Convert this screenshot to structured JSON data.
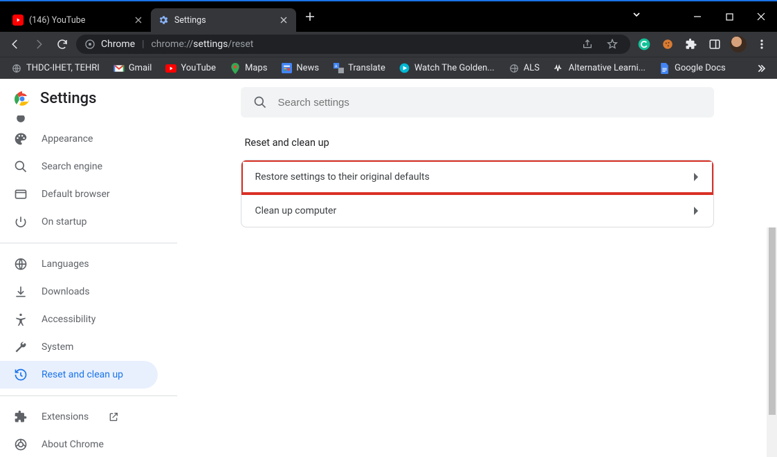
{
  "tabs": [
    {
      "title": "(146) YouTube",
      "favicon": "youtube",
      "active": false
    },
    {
      "title": "Settings",
      "favicon": "settings",
      "active": true
    }
  ],
  "omnibox": {
    "prefix": "Chrome",
    "path_grey1": "chrome://",
    "path_white": "settings",
    "path_grey2": "/reset"
  },
  "bookmarks": [
    {
      "label": "THDC-IHET, TEHRI",
      "icon": "globe"
    },
    {
      "label": "Gmail",
      "icon": "gmail"
    },
    {
      "label": "YouTube",
      "icon": "youtube"
    },
    {
      "label": "Maps",
      "icon": "maps"
    },
    {
      "label": "News",
      "icon": "news"
    },
    {
      "label": "Translate",
      "icon": "translate"
    },
    {
      "label": "Watch The Golden...",
      "icon": "play"
    },
    {
      "label": "ALS",
      "icon": "globe"
    },
    {
      "label": "Alternative Learni...",
      "icon": "wave"
    },
    {
      "label": "Google Docs",
      "icon": "docs"
    }
  ],
  "settings": {
    "title": "Settings",
    "search_placeholder": "Search settings",
    "nav": [
      {
        "id": "appearance",
        "label": "Appearance",
        "icon": "palette"
      },
      {
        "id": "search-engine",
        "label": "Search engine",
        "icon": "search"
      },
      {
        "id": "default-browser",
        "label": "Default browser",
        "icon": "browser"
      },
      {
        "id": "on-startup",
        "label": "On startup",
        "icon": "power"
      }
    ],
    "nav2": [
      {
        "id": "languages",
        "label": "Languages",
        "icon": "globe"
      },
      {
        "id": "downloads",
        "label": "Downloads",
        "icon": "download"
      },
      {
        "id": "accessibility",
        "label": "Accessibility",
        "icon": "accessibility"
      },
      {
        "id": "system",
        "label": "System",
        "icon": "wrench"
      },
      {
        "id": "reset",
        "label": "Reset and clean up",
        "icon": "restore",
        "selected": true
      }
    ],
    "nav3": [
      {
        "id": "extensions",
        "label": "Extensions",
        "icon": "extension",
        "external": true
      },
      {
        "id": "about",
        "label": "About Chrome",
        "icon": "chrome"
      }
    ],
    "section_title": "Reset and clean up",
    "rows": [
      {
        "id": "restore",
        "label": "Restore settings to their original defaults",
        "highlight": true
      },
      {
        "id": "cleanup",
        "label": "Clean up computer",
        "highlight": false
      }
    ]
  }
}
